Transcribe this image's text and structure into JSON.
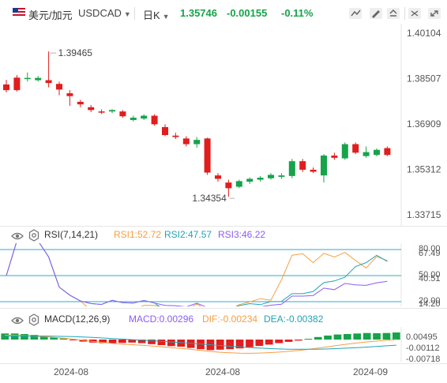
{
  "toolbar": {
    "symbol": "美元/加元",
    "code": "USDCAD",
    "timeframe": "日K",
    "price": "1.35746",
    "change": "-0.00155",
    "change_pct": "-0.11%"
  },
  "main_chart": {
    "y_axis": [
      "1.40104",
      "1.38507",
      "1.36909",
      "1.35312",
      "1.33715"
    ],
    "high_label": "1.39465",
    "low_label": "1.34354",
    "candles": [
      {
        "o": 1.381,
        "c": 1.383,
        "h": 1.3846,
        "l": 1.3802,
        "up": false
      },
      {
        "o": 1.381,
        "c": 1.3854,
        "h": 1.3863,
        "l": 1.3805,
        "up": false
      },
      {
        "o": 1.3853,
        "c": 1.3852,
        "h": 1.3872,
        "l": 1.384,
        "up": true
      },
      {
        "o": 1.3845,
        "c": 1.3853,
        "h": 1.386,
        "l": 1.384,
        "up": true
      },
      {
        "o": 1.3835,
        "c": 1.3845,
        "h": 1.3946,
        "l": 1.382,
        "up": false
      },
      {
        "o": 1.3832,
        "c": 1.3812,
        "h": 1.384,
        "l": 1.3792,
        "up": false
      },
      {
        "o": 1.3799,
        "c": 1.3789,
        "h": 1.381,
        "l": 1.3755,
        "up": false
      },
      {
        "o": 1.3769,
        "c": 1.376,
        "h": 1.3776,
        "l": 1.375,
        "up": false
      },
      {
        "o": 1.375,
        "c": 1.374,
        "h": 1.3758,
        "l": 1.3733,
        "up": false
      },
      {
        "o": 1.3735,
        "c": 1.3731,
        "h": 1.3742,
        "l": 1.3726,
        "up": false
      },
      {
        "o": 1.3735,
        "c": 1.374,
        "h": 1.3743,
        "l": 1.3729,
        "up": true
      },
      {
        "o": 1.3735,
        "c": 1.3718,
        "h": 1.374,
        "l": 1.3713,
        "up": false
      },
      {
        "o": 1.3705,
        "c": 1.3713,
        "h": 1.372,
        "l": 1.37,
        "up": true
      },
      {
        "o": 1.371,
        "c": 1.372,
        "h": 1.3725,
        "l": 1.3705,
        "up": true
      },
      {
        "o": 1.372,
        "c": 1.369,
        "h": 1.3725,
        "l": 1.3685,
        "up": false
      },
      {
        "o": 1.368,
        "c": 1.3652,
        "h": 1.369,
        "l": 1.3648,
        "up": false
      },
      {
        "o": 1.365,
        "c": 1.3645,
        "h": 1.366,
        "l": 1.3638,
        "up": false
      },
      {
        "o": 1.364,
        "c": 1.362,
        "h": 1.3648,
        "l": 1.3612,
        "up": false
      },
      {
        "o": 1.362,
        "c": 1.3635,
        "h": 1.3645,
        "l": 1.3608,
        "up": true
      },
      {
        "o": 1.364,
        "c": 1.352,
        "h": 1.3643,
        "l": 1.3512,
        "up": false
      },
      {
        "o": 1.351,
        "c": 1.3498,
        "h": 1.3518,
        "l": 1.3488,
        "up": false
      },
      {
        "o": 1.3485,
        "c": 1.3465,
        "h": 1.3495,
        "l": 1.3435,
        "up": false
      },
      {
        "o": 1.347,
        "c": 1.349,
        "h": 1.3495,
        "l": 1.3465,
        "up": true
      },
      {
        "o": 1.3488,
        "c": 1.3498,
        "h": 1.3503,
        "l": 1.348,
        "up": true
      },
      {
        "o": 1.3495,
        "c": 1.3502,
        "h": 1.3508,
        "l": 1.3488,
        "up": true
      },
      {
        "o": 1.35,
        "c": 1.3512,
        "h": 1.3518,
        "l": 1.3495,
        "up": true
      },
      {
        "o": 1.3505,
        "c": 1.351,
        "h": 1.3518,
        "l": 1.3498,
        "up": true
      },
      {
        "o": 1.3508,
        "c": 1.356,
        "h": 1.3568,
        "l": 1.35,
        "up": true
      },
      {
        "o": 1.356,
        "c": 1.353,
        "h": 1.3568,
        "l": 1.3522,
        "up": false
      },
      {
        "o": 1.353,
        "c": 1.3523,
        "h": 1.3538,
        "l": 1.3518,
        "up": false
      },
      {
        "o": 1.351,
        "c": 1.358,
        "h": 1.3585,
        "l": 1.3485,
        "up": true
      },
      {
        "o": 1.358,
        "c": 1.3572,
        "h": 1.359,
        "l": 1.3565,
        "up": false
      },
      {
        "o": 1.357,
        "c": 1.362,
        "h": 1.3626,
        "l": 1.3565,
        "up": true
      },
      {
        "o": 1.362,
        "c": 1.359,
        "h": 1.3626,
        "l": 1.3585,
        "up": false
      },
      {
        "o": 1.3578,
        "c": 1.3592,
        "h": 1.3612,
        "l": 1.3572,
        "up": true
      },
      {
        "o": 1.3582,
        "c": 1.36,
        "h": 1.3605,
        "l": 1.3577,
        "up": true
      },
      {
        "o": 1.3606,
        "c": 1.3582,
        "h": 1.3612,
        "l": 1.3578,
        "up": false
      }
    ]
  },
  "rsi": {
    "title": "RSI(7,14,21)",
    "rsi1": "RSI1:52.72",
    "rsi2": "RSI2:47.57",
    "rsi3": "RSI3:46.22",
    "levels": [
      "80.00",
      "67.49",
      "50.00",
      "40.51",
      "20.00",
      "14.20"
    ]
  },
  "macd": {
    "title": "MACD(12,26,9)",
    "macd_label": "MACD:0.00296",
    "dif_label": "DIF:-0.00234",
    "dea_label": "DEA:-0.00382",
    "axis": [
      "0.00495",
      "-0.00112",
      "-0.00718"
    ],
    "hist": [
      0.0024,
      0.0024,
      0.0022,
      0.0018,
      0.0014,
      0.0008,
      0.0004,
      -0.0002,
      -0.0008,
      -0.0012,
      -0.0014,
      -0.0014,
      -0.0013,
      -0.0012,
      -0.0014,
      -0.0018,
      -0.0022,
      -0.0026,
      -0.0028,
      -0.0033,
      -0.0038,
      -0.0042,
      -0.004,
      -0.0038,
      -0.0035,
      -0.003,
      -0.0025,
      -0.002,
      -0.0014,
      -0.0009,
      -0.0004,
      0.0003,
      0.001,
      0.0016,
      0.002,
      0.0022,
      0.0024,
      0.0026,
      0.0025,
      0.0026,
      0.0028
    ]
  },
  "x_axis": [
    "2024-08",
    "2024-08",
    "2024-09"
  ],
  "colors": {
    "up": "#16a34a",
    "down": "#e11d1d",
    "rsi1": "#f59e42",
    "rsi2": "#22a3b5",
    "rsi3": "#8b5cf6",
    "dif": "#f59e42",
    "dea": "#22a3b5"
  }
}
